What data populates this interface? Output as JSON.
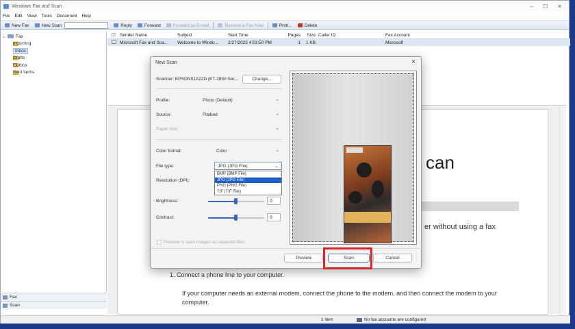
{
  "window": {
    "title": "Windows Fax and Scan"
  },
  "menu": [
    "File",
    "Edit",
    "View",
    "Tools",
    "Document",
    "Help"
  ],
  "toolbar": {
    "new_fax": "New Fax",
    "new_scan": "New Scan",
    "reply": "Reply",
    "forward": "Forward",
    "forward_email": "Forward as E-mail",
    "receive": "Receive a Fax Now",
    "print": "Print...",
    "delete": "Delete"
  },
  "tree": {
    "root": "Fax",
    "items": [
      "Incoming",
      "Inbox",
      "Drafts",
      "Outbox",
      "Sent Items"
    ]
  },
  "bottom_nav": [
    "Fax",
    "Scan"
  ],
  "list": {
    "headers": [
      "Sender Name",
      "Subject",
      "Start Time",
      "Pages",
      "Size",
      "Caller ID",
      "Fax Account"
    ],
    "rows": [
      {
        "sender": "Microsoft Fax and Sca...",
        "subject": "Welcome to Windo...",
        "time": "2/27/2022 4:03:50 PM",
        "pages": "1",
        "size": "1 KB",
        "caller": "",
        "account": "Microsoft"
      }
    ]
  },
  "document": {
    "heading": "can",
    "line": "er without using a fax",
    "step": "1.    Connect a phone line to your computer.",
    "para": "If your computer needs an external modem, connect the phone to the modem, and then connect the modem to your computer."
  },
  "status": {
    "count": "1 item",
    "fax": "No fax accounts are configured"
  },
  "dialog": {
    "title": "New Scan",
    "scanner_label": "Scanner: EPSON01A22D (ET-2850 Ser...",
    "change_button": "Change...",
    "profile_label": "Profile:",
    "profile_value": "Photo (Default)",
    "source_label": "Source:",
    "source_value": "Flatbed",
    "paper_label": "Paper size:",
    "color_label": "Color format:",
    "color_value": "Color",
    "filetype_label": "File type:",
    "filetype_value": "JPG (JPG File)",
    "filetype_options": [
      "BMP (BMP File)",
      "JPG (JPG File)",
      "PNG (PNG File)",
      "TIF (TIF File)"
    ],
    "filetype_selected_index": 1,
    "resolution_label": "Resolution (DPI):",
    "brightness_label": "Brightness:",
    "brightness_value": "0",
    "contrast_label": "Contrast:",
    "contrast_value": "0",
    "separate_files_label": "Preview or scan images as separate files",
    "preview_button": "Preview",
    "scan_button": "Scan",
    "cancel_button": "Cancel"
  },
  "colors": {
    "highlight": "#d6262e",
    "selection": "#1f5cc8",
    "slider": "#3a64c2"
  }
}
